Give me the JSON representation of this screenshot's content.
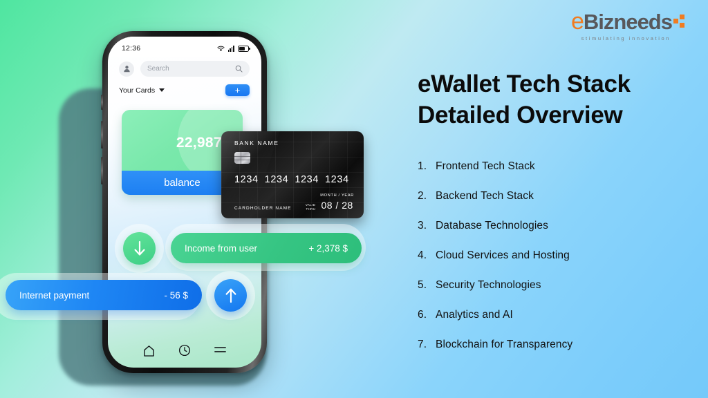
{
  "brand": {
    "logo_e": "e",
    "logo_name": "Bizneeds",
    "tagline": "stimulating innovation",
    "accent_color": "#f07c21",
    "text_color": "#58585b"
  },
  "headline": {
    "line1": "eWallet Tech Stack",
    "line2": "Detailed Overview"
  },
  "topics": [
    {
      "num": "1.",
      "label": "Frontend Tech Stack"
    },
    {
      "num": "2.",
      "label": "Backend Tech Stack"
    },
    {
      "num": "3.",
      "label": "Database Technologies"
    },
    {
      "num": "4.",
      "label": "Cloud Services and Hosting"
    },
    {
      "num": "5.",
      "label": "Security Technologies"
    },
    {
      "num": "6.",
      "label": "Analytics and AI"
    },
    {
      "num": "7.",
      "label": "Blockchain for Transparency"
    }
  ],
  "phone": {
    "statusbar": {
      "time": "12:36",
      "wifi_icon": "wifi-icon",
      "signal_icon": "signal-bars-icon",
      "battery_icon": "battery-icon"
    },
    "header": {
      "avatar_icon": "user-avatar-icon",
      "search_placeholder": "Search",
      "search_icon": "search-icon",
      "cards_label": "Your Cards",
      "caret_icon": "chevron-down-icon",
      "add_label": "+"
    },
    "balance_card": {
      "amount": "22,987 $",
      "label": "balance",
      "color": "#6fe5a3",
      "strip_color": "#1d7ff2"
    },
    "bank_card": {
      "bank_name": "BANK  NAME",
      "chip_icon": "emv-chip-icon",
      "number_groups": [
        "1234",
        "1234",
        "1234",
        "1234"
      ],
      "holder_label": "CARDHOLDER NAME",
      "valid_label": "VALID\nTHRU",
      "valid_line1": "VALID",
      "valid_line2": "THRU",
      "expiry_label": "MONTH / YEAR",
      "expiry_value": "08 / 28"
    },
    "transactions": [
      {
        "icon": "arrow-down-icon",
        "title": "Income from user",
        "amount": "+ 2,378 $",
        "color": "#2dbe7b",
        "direction": "in"
      },
      {
        "icon": "arrow-up-icon",
        "title": "Internet payment",
        "amount": "- 56 $",
        "color": "#1477f0",
        "direction": "out"
      }
    ],
    "nav": [
      {
        "icon": "home-icon",
        "name": "home"
      },
      {
        "icon": "clock-history-icon",
        "name": "history"
      },
      {
        "icon": "menu-icon",
        "name": "menu"
      }
    ]
  },
  "background": {
    "from": "#4fe6a0",
    "to": "#74c9fa"
  }
}
